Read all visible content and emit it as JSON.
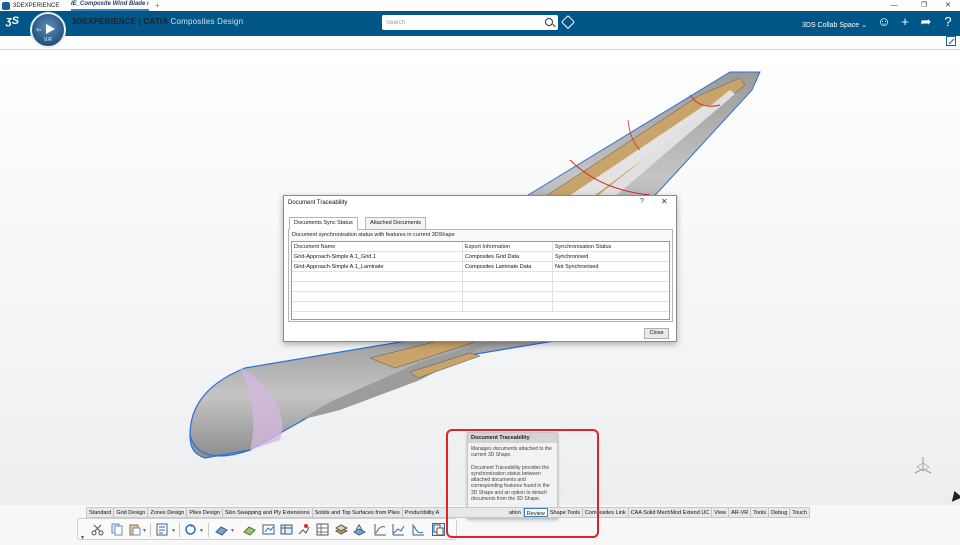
{
  "window": {
    "title": "3DEXPERIENCE",
    "minimize": "—",
    "restore": "❐",
    "close": "✕"
  },
  "header": {
    "brand_bold": "3DEXPERIENCE | CATIA",
    "brand_app": "Composites Design",
    "search_placeholder": "Search",
    "collab_space": "3DS Collab Space",
    "compass_label": "V.R",
    "compass_3d": "3D",
    "ds_logo": "ʒS",
    "icons": [
      "user-icon",
      "add-icon",
      "share-icon",
      "help-icon"
    ],
    "icon_glyphs": [
      "☺",
      "+",
      "➦",
      "?"
    ]
  },
  "tabs": {
    "document_tab": "IE_Composite Wind Blade",
    "document_tab_suffix": "ı",
    "add_tab": "+"
  },
  "dialog": {
    "title": "Document Traceability",
    "help": "?",
    "close_x": "✕",
    "tabs": [
      "Documents Sync Status",
      "Attached Documents"
    ],
    "active_tab": "Documents Sync Status",
    "caption": "Document synchronisation status with features in current 3DShape",
    "columns": [
      "Document Name",
      "Export Information",
      "Synchronisation Status"
    ],
    "rows": [
      [
        "Grid-Approach-Simple A.1_Grid.1",
        "Composites Grid Data",
        "Synchronised"
      ],
      [
        "Grid-Approach-Simple A.1_Laminate",
        "Composites Laminate Data",
        "Not Synchronised"
      ]
    ],
    "close_button": "Close"
  },
  "tooltip": {
    "title": "Document Traceability",
    "summary": "Manages documents attached to the current 3D Shape.",
    "description": "Document Traceability provides the synchronization status between attached documents and corresponding features found in the 3D Shape and an option to detach documents from the 3D Shape."
  },
  "action_bar": {
    "tabs": [
      "Standard",
      "Grid Design",
      "Zones Design",
      "Plies Design",
      "Skin Swapping and Ply Extensions",
      "Solids and Top Surfaces from Plies",
      "Producibility A",
      "ation",
      "Review",
      "Shape Tools",
      "Composites Link",
      "CAA Solid MechMod Extend UC",
      "View",
      "AR-VR",
      "Tools",
      "Debug",
      "Touch"
    ],
    "active_tab": "Review",
    "tools": [
      "cut-icon",
      "copy-icon",
      "paste-icon",
      "properties-icon",
      "update-icon",
      "measure-icon",
      "check-icon",
      "compare-icon",
      "review-icon",
      "annotate-icon",
      "ply-table-icon",
      "layers-icon",
      "section-icon",
      "curve-icon",
      "analysis-icon",
      "graph-icon",
      "document-traceability-icon"
    ]
  },
  "colors": {
    "header_bg": "#005686",
    "accent": "#3a83c4",
    "highlight": "#d9262b",
    "model_blue": "#2e6fd6",
    "ply_tan": "#c9a46a",
    "red_curve": "#d22e2e"
  }
}
